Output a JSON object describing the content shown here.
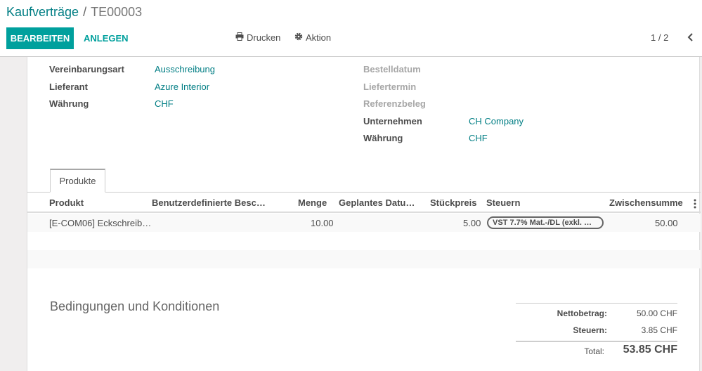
{
  "breadcrumb": {
    "parent": "Kaufverträge",
    "separator": "/",
    "current": "TE00003"
  },
  "toolbar": {
    "edit_label": "BEARBEITEN",
    "create_label": "ANLEGEN",
    "print_label": "Drucken",
    "action_label": "Aktion"
  },
  "pager": {
    "value": "1 / 2"
  },
  "left_fields": [
    {
      "label": "Vereinbarungsart",
      "value": "Ausschreibung"
    },
    {
      "label": "Lieferant",
      "value": "Azure Interior"
    },
    {
      "label": "Währung",
      "value": "CHF"
    }
  ],
  "right_fields": [
    {
      "label": "Bestelldatum",
      "value": ""
    },
    {
      "label": "Liefertermin",
      "value": ""
    },
    {
      "label": "Referenzbeleg",
      "value": ""
    },
    {
      "label": "Unternehmen",
      "value": "CH Company"
    },
    {
      "label": "Währung",
      "value": "CHF"
    }
  ],
  "tabs": [
    {
      "label": "Produkte"
    }
  ],
  "table": {
    "headers": [
      "Produkt",
      "Benutzerdefinierte Besc…",
      "Menge",
      "Geplantes Datu…",
      "Stückpreis",
      "Steuern",
      "Zwischensumme"
    ],
    "rows": [
      {
        "product": "[E-COM06] Eckschreib…",
        "description": "",
        "quantity": "10.00",
        "planned_date": "",
        "unit_price": "5.00",
        "taxes": "VST 7.7% Mat.-/DL (exkl. …",
        "subtotal": "50.00"
      }
    ]
  },
  "terms_title": "Bedingungen und Konditionen",
  "totals": {
    "net_label": "Nettobetrag:",
    "net_value": "50.00 CHF",
    "tax_label": "Steuern:",
    "tax_value": "3.85 CHF",
    "total_label": "Total:",
    "total_value": "53.85 CHF"
  },
  "colors": {
    "primary": "#00a09d",
    "link": "#017e84"
  }
}
